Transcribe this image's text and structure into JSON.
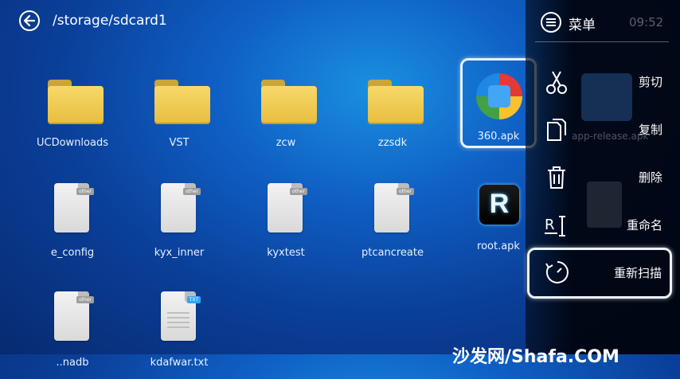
{
  "header": {
    "path": "/storage/sdcard1"
  },
  "grid": {
    "row1": [
      "UCDownloads",
      "VST",
      "zcw",
      "zzsdk",
      "360.apk"
    ],
    "row2": [
      "e_config",
      "kyx_inner",
      "kyxtest",
      "ptcancreate",
      "root.apk"
    ],
    "row3": [
      "..nadb",
      "kdafwar.txt"
    ]
  },
  "badges": {
    "other": "other",
    "txt": "TXT"
  },
  "menu": {
    "title": "菜单",
    "time": "09:52",
    "items": [
      {
        "label": "剪切",
        "icon": "scissors-icon"
      },
      {
        "label": "复制",
        "icon": "copy-icon"
      },
      {
        "label": "删除",
        "icon": "trash-icon"
      },
      {
        "label": "重命名",
        "icon": "rename-icon"
      },
      {
        "label": "重新扫描",
        "icon": "rescan-icon"
      }
    ],
    "ghost_label": "app-release.apk"
  },
  "watermark": "沙发网/Shafa.COM"
}
